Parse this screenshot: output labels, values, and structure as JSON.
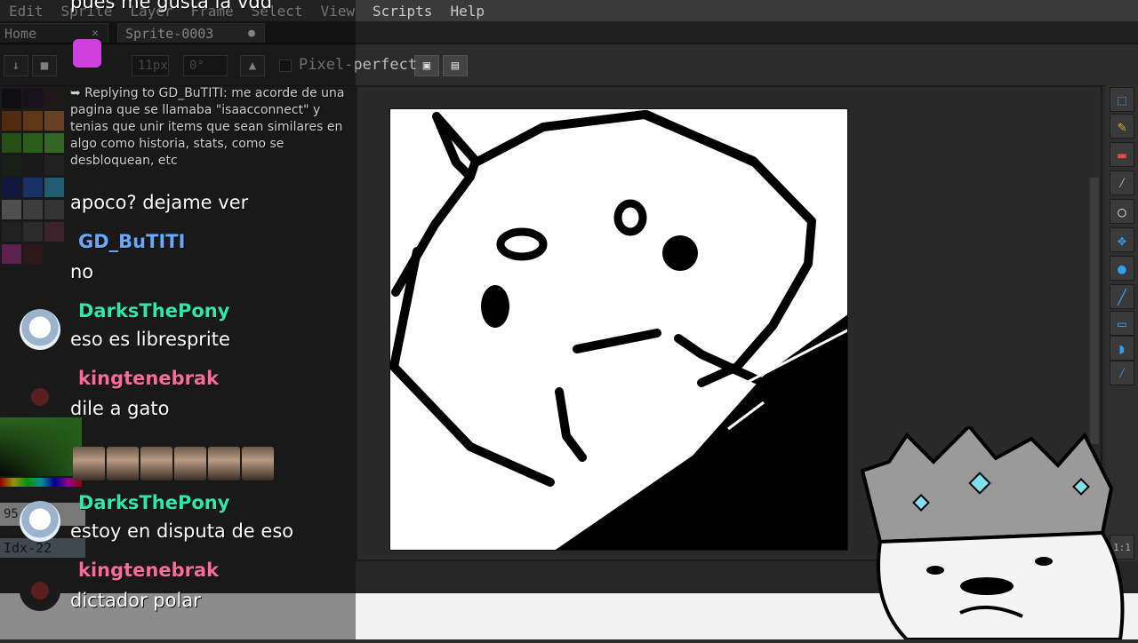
{
  "menu": {
    "items": [
      "Edit",
      "Sprite",
      "Layer",
      "Frame",
      "Select",
      "View",
      "Scripts",
      "Help"
    ],
    "overlay_text": "pues me gusta la vdd"
  },
  "tabs": [
    {
      "label": "Home",
      "close": "✕"
    },
    {
      "label": "Sprite-0003",
      "close": "●"
    }
  ],
  "toolbar": {
    "brush_size": "11px",
    "angle": "0°",
    "pixel_perfect_label": "Pixel-perfect"
  },
  "palette": {
    "colors": [
      "#1a1a22",
      "#2a2030",
      "#3a2a2a",
      "#8a4a20",
      "#a0602a",
      "#b07040",
      "#3e8a2a",
      "#4aa030",
      "#5ab040",
      "#2a3a2a",
      "#2a2a2a",
      "#3a3a3a",
      "#1e2a6a",
      "#2a5ab0",
      "#3aa0c0",
      "#8a8a8a",
      "#6a6a6a",
      "#5a5a5a",
      "#3a3a3a",
      "#4a4a4a",
      "#6a3a4a",
      "#a03a8a",
      "#4a2a2a",
      "#2a2a2a"
    ],
    "alpha_value": "95",
    "index_label": "Idx-22"
  },
  "chat": {
    "reply_text": "➥ Replying to GD_BuTITI: me acorde de una pagina que se llamaba \"isaacconnect\" y tenias que unir items que sean similares en algo como historia, stats, como se desbloquean, etc",
    "messages": [
      {
        "user": "",
        "text": "apoco? dejame ver"
      },
      {
        "user": "GD_BuTITI",
        "color": "#6aa8ff",
        "text": "no"
      },
      {
        "user": "DarksThePony",
        "color": "#2ee8a8",
        "text": "eso es libresprite"
      },
      {
        "user": "kingtenebrak",
        "color": "#ff6a9a",
        "text": "dile a gato"
      },
      {
        "user": "DarksThePony",
        "color": "#2ee8a8",
        "text": "estoy en disputa de eso"
      },
      {
        "user": "kingtenebrak",
        "color": "#ff6a9a",
        "text": "dictador polar"
      }
    ]
  },
  "right_tools": [
    "marquee-icon",
    "pencil-icon",
    "eraser-icon",
    "eyedropper-icon",
    "zoom-icon",
    "move-icon",
    "fill-icon",
    "line-icon",
    "rectangle-icon",
    "curve-icon",
    "blur-icon"
  ],
  "status": {
    "zoom_button": "1:1"
  }
}
